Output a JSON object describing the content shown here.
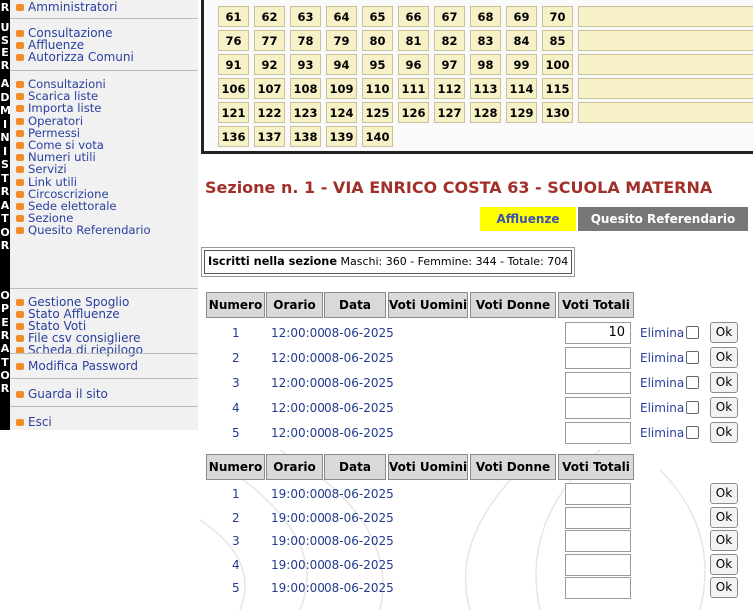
{
  "vertical_labels": {
    "user": [
      "U",
      "S",
      "E",
      "R"
    ],
    "admin": [
      "A",
      "D",
      "M",
      "I",
      "N",
      "I",
      "S",
      "T",
      "R",
      "A",
      "T",
      "O",
      "R"
    ],
    "operator": [
      "O",
      "P",
      "E",
      "R",
      "A",
      "T",
      "O",
      "R"
    ],
    "top": "R"
  },
  "sidebar": {
    "top_item": "Amministratori",
    "user_items": [
      "Consultazione",
      "Affluenze",
      "Autorizza Comuni"
    ],
    "admin_items": [
      "Consultazioni",
      "Scarica liste",
      "Importa liste",
      "Operatori",
      "Permessi",
      "Come si vota",
      "Numeri utili",
      "Servizi",
      "Link utili",
      "Circoscrizione",
      "Sede elettorale",
      "Sezione",
      "Quesito Referendario"
    ],
    "operator_items": [
      "Gestione Spoglio",
      "Stato Affluenze",
      "Stato Voti",
      "File csv consigliere",
      "Scheda di riepilogo"
    ],
    "password": "Modifica Password",
    "site": "Guarda il sito",
    "exit": "Esci"
  },
  "grid_rows": [
    [
      "61",
      "62",
      "63",
      "64",
      "65",
      "66",
      "67",
      "68",
      "69",
      "70"
    ],
    [
      "76",
      "77",
      "78",
      "79",
      "80",
      "81",
      "82",
      "83",
      "84",
      "85"
    ],
    [
      "91",
      "92",
      "93",
      "94",
      "95",
      "96",
      "97",
      "98",
      "99",
      "100"
    ],
    [
      "106",
      "107",
      "108",
      "109",
      "110",
      "111",
      "112",
      "113",
      "114",
      "115"
    ],
    [
      "121",
      "122",
      "123",
      "124",
      "125",
      "126",
      "127",
      "128",
      "129",
      "130"
    ],
    [
      "136",
      "137",
      "138",
      "139",
      "140"
    ]
  ],
  "section": {
    "title": "Sezione n. 1 - VIA ENRICO COSTA 63 - SCUOLA MATERNA",
    "tab_affluenze": "Affluenze",
    "tab_referendario": "Quesito Referendario",
    "iscritti_label": "Iscritti nella sezione",
    "iscritti_values": " Maschi: 360 - Femmine: 344 - Totale: 704"
  },
  "table": {
    "headers": [
      "Numero",
      "Orario",
      "Data",
      "Voti Uomini",
      "Voti Donne",
      "Voti Totali"
    ],
    "elimina": "Elimina",
    "ok": "Ok",
    "date": "08-06-2025",
    "group1_time": "12:00:00",
    "group2_time": "19:00:00",
    "numbers": [
      "1",
      "2",
      "3",
      "4",
      "5"
    ],
    "first_value": "10"
  },
  "colors": {
    "accent_title": "#a1302a",
    "link": "#2a3f9e",
    "bullet": "#f28c28",
    "tab_active": "#ffff00"
  }
}
